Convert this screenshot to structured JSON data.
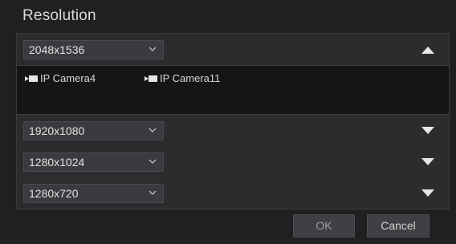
{
  "dialog": {
    "title": "Resolution",
    "groups": [
      {
        "resolution": "2048x1536",
        "expanded": true,
        "cameras": [
          "IP Camera4",
          "IP Camera11"
        ]
      },
      {
        "resolution": "1920x1080",
        "expanded": false
      },
      {
        "resolution": "1280x1024",
        "expanded": false
      },
      {
        "resolution": "1280x720",
        "expanded": false
      }
    ],
    "ok_label": "OK",
    "cancel_label": "Cancel"
  },
  "icons": {
    "chevron": "chevron-down-icon",
    "expand": "triangle-up-icon",
    "collapse": "triangle-down-icon",
    "camera": "camera-icon"
  },
  "colors": {
    "background": "#1f2022",
    "row": "#2b2c2e",
    "select": "#3a3b3e",
    "text": "#d6d6d6"
  }
}
